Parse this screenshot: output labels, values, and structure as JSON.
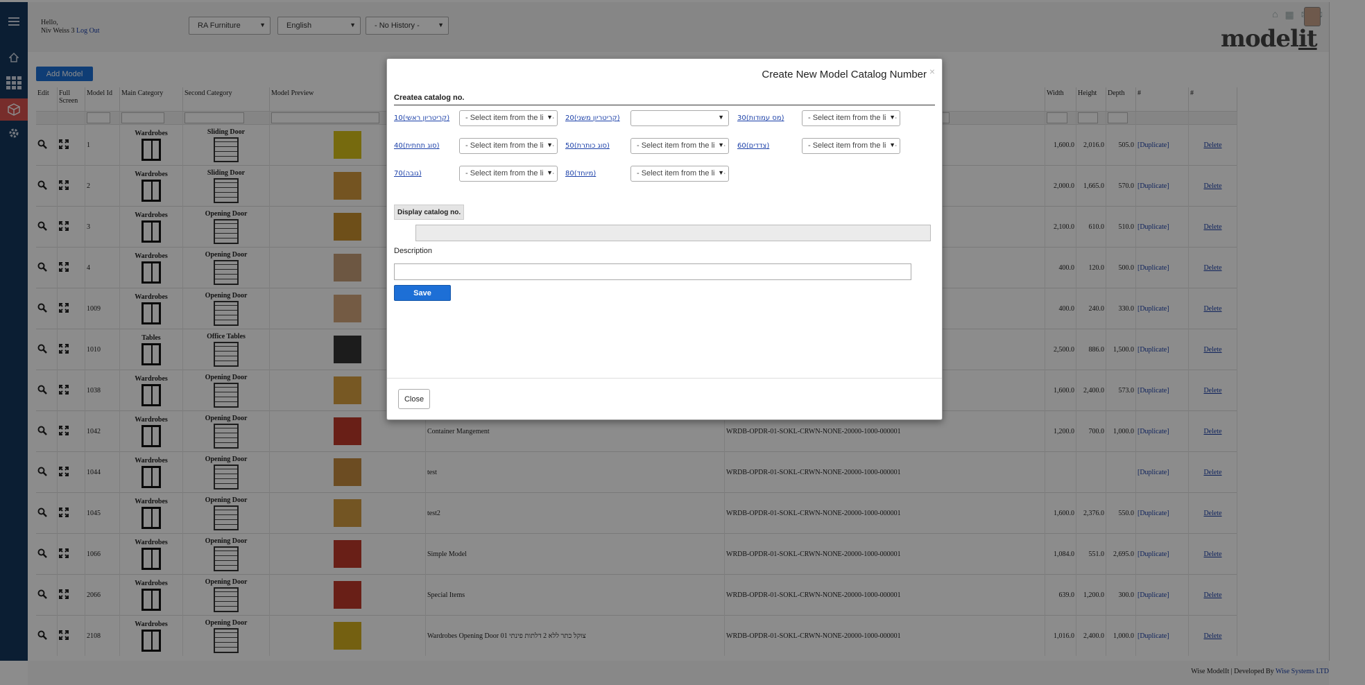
{
  "header": {
    "hello": "Hello,",
    "user_name": "Niv Weiss 3",
    "logout": "Log Out",
    "company_select": "RA Furniture",
    "language_select": "English",
    "history_select": "- No History -",
    "logo_text": "model",
    "logo_text_tail": "it"
  },
  "sidebar": {
    "items": [
      {
        "icon": "menu-icon"
      },
      {
        "icon": "home-icon"
      },
      {
        "icon": "grid-icon"
      },
      {
        "icon": "cube-icon"
      },
      {
        "icon": "gear-icon"
      }
    ]
  },
  "toolbar": {
    "add_model": "Add Model"
  },
  "table": {
    "headers": {
      "edit": "Edit",
      "full_screen": "Full Screen",
      "model_id": "Model Id",
      "main_category": "Main Category",
      "second_category": "Second Category",
      "model_preview": "Model Preview",
      "width": "Width",
      "height": "Height",
      "depth": "Depth",
      "hash1": "#",
      "hash2": "#"
    },
    "rows": [
      {
        "id": "1",
        "main": "Wardrobes",
        "second": "Sliding Door",
        "name": "",
        "catalog": "",
        "width": "1,600.0",
        "height": "2,016.0",
        "depth": "505.0"
      },
      {
        "id": "2",
        "main": "Wardrobes",
        "second": "Sliding Door",
        "name": "",
        "catalog": "",
        "width": "2,000.0",
        "height": "1,665.0",
        "depth": "570.0"
      },
      {
        "id": "3",
        "main": "Wardrobes",
        "second": "Opening Door",
        "name": "",
        "catalog": "",
        "width": "2,100.0",
        "height": "610.0",
        "depth": "510.0"
      },
      {
        "id": "4",
        "main": "Wardrobes",
        "second": "Opening Door",
        "name": "",
        "catalog": "",
        "width": "400.0",
        "height": "120.0",
        "depth": "500.0"
      },
      {
        "id": "1009",
        "main": "Wardrobes",
        "second": "Opening Door",
        "name": "",
        "catalog": "",
        "width": "400.0",
        "height": "240.0",
        "depth": "330.0"
      },
      {
        "id": "1010",
        "main": "Tables",
        "second": "Office Tables",
        "name": "",
        "catalog": "",
        "width": "2,500.0",
        "height": "886.0",
        "depth": "1,500.0"
      },
      {
        "id": "1038",
        "main": "Wardrobes",
        "second": "Opening Door",
        "name": "",
        "catalog": "",
        "width": "1,600.0",
        "height": "2,400.0",
        "depth": "573.0"
      },
      {
        "id": "1042",
        "main": "Wardrobes",
        "second": "Opening Door",
        "name": "Container Mangement",
        "catalog": "WRDB-OPDR-01-SOKL-CRWN-NONE-20000-1000-000001",
        "width": "1,200.0",
        "height": "700.0",
        "depth": "1,000.0"
      },
      {
        "id": "1044",
        "main": "Wardrobes",
        "second": "Opening Door",
        "name": "test",
        "catalog": "WRDB-OPDR-01-SOKL-CRWN-NONE-20000-1000-000001",
        "width": "",
        "height": "",
        "depth": ""
      },
      {
        "id": "1045",
        "main": "Wardrobes",
        "second": "Opening Door",
        "name": "test2",
        "catalog": "WRDB-OPDR-01-SOKL-CRWN-NONE-20000-1000-000001",
        "width": "1,600.0",
        "height": "2,376.0",
        "depth": "550.0"
      },
      {
        "id": "1066",
        "main": "Wardrobes",
        "second": "Opening Door",
        "name": "Simple Model",
        "catalog": "WRDB-OPDR-01-SOKL-CRWN-NONE-20000-1000-000001",
        "width": "1,084.0",
        "height": "551.0",
        "depth": "2,695.0"
      },
      {
        "id": "2066",
        "main": "Wardrobes",
        "second": "Opening Door",
        "name": "Special Items",
        "catalog": "WRDB-OPDR-01-SOKL-CRWN-NONE-20000-1000-000001",
        "width": "639.0",
        "height": "1,200.0",
        "depth": "300.0"
      },
      {
        "id": "2108",
        "main": "Wardrobes",
        "second": "Opening Door",
        "name": "Wardrobes Opening Door צוקל כתר ללא 2 דלתות פינתי 01",
        "catalog": "WRDB-OPDR-01-SOKL-CRWN-NONE-20000-1000-000001",
        "width": "1,016.0",
        "height": "2,400.0",
        "depth": "1,000.0"
      }
    ],
    "duplicate_label": "[Duplicate]",
    "delete_label": "Delete"
  },
  "modal": {
    "title": "Create New Model Catalog Number",
    "close_x": "×",
    "section_title": "Createa catalog no.",
    "criteria": [
      {
        "label": "10(קריטריון ראשי)",
        "select": "- Select item from the list -"
      },
      {
        "label": "20(קריטריון משני)",
        "select": ""
      },
      {
        "label": "30(מס עמודות)",
        "select": "- Select item from the list -"
      },
      {
        "label": "40(סוג תחתית)",
        "select": "- Select item from the list -"
      },
      {
        "label": "50(סוג כותרת)",
        "select": "- Select item from the list -"
      },
      {
        "label": "60(צדדים)",
        "select": "- Select item from the list -"
      },
      {
        "label": "70(גובה)",
        "select": "- Select item from the list -"
      },
      {
        "label": "80(מיוחד)",
        "select": "- Select item from the list -"
      }
    ],
    "display_button": "Display catalog no.",
    "description_label": "Description",
    "save_button": "Save",
    "close_button": "Close"
  },
  "footer": {
    "app": "Wise ModelIt",
    "developed_by": "Developed By",
    "company": "Wise Systems LTD"
  }
}
